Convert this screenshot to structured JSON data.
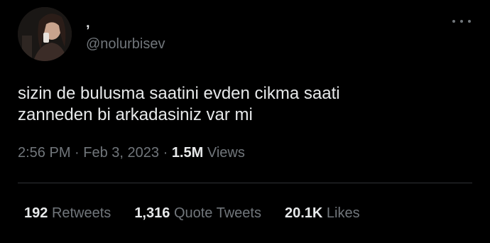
{
  "author": {
    "display_name": "‚",
    "handle": "@nolurbisev"
  },
  "tweet": {
    "lines": [
      "sizin de bulusma saatini evden cikma saati",
      "zanneden bi arkadasiniz var mi"
    ],
    "time": "2:56 PM",
    "separator": "·",
    "date": "Feb 3, 2023",
    "views_count": "1.5M",
    "views_label": "Views"
  },
  "stats": {
    "retweets": {
      "count": "192",
      "label": "Retweets"
    },
    "quotes": {
      "count": "1,316",
      "label": "Quote Tweets"
    },
    "likes": {
      "count": "20.1K",
      "label": "Likes"
    }
  },
  "icons": {
    "more": "more-horizontal-icon"
  },
  "colors": {
    "background": "#000000",
    "text_primary": "#e7e9ea",
    "text_secondary": "#71767b",
    "divider": "#2f3336"
  }
}
